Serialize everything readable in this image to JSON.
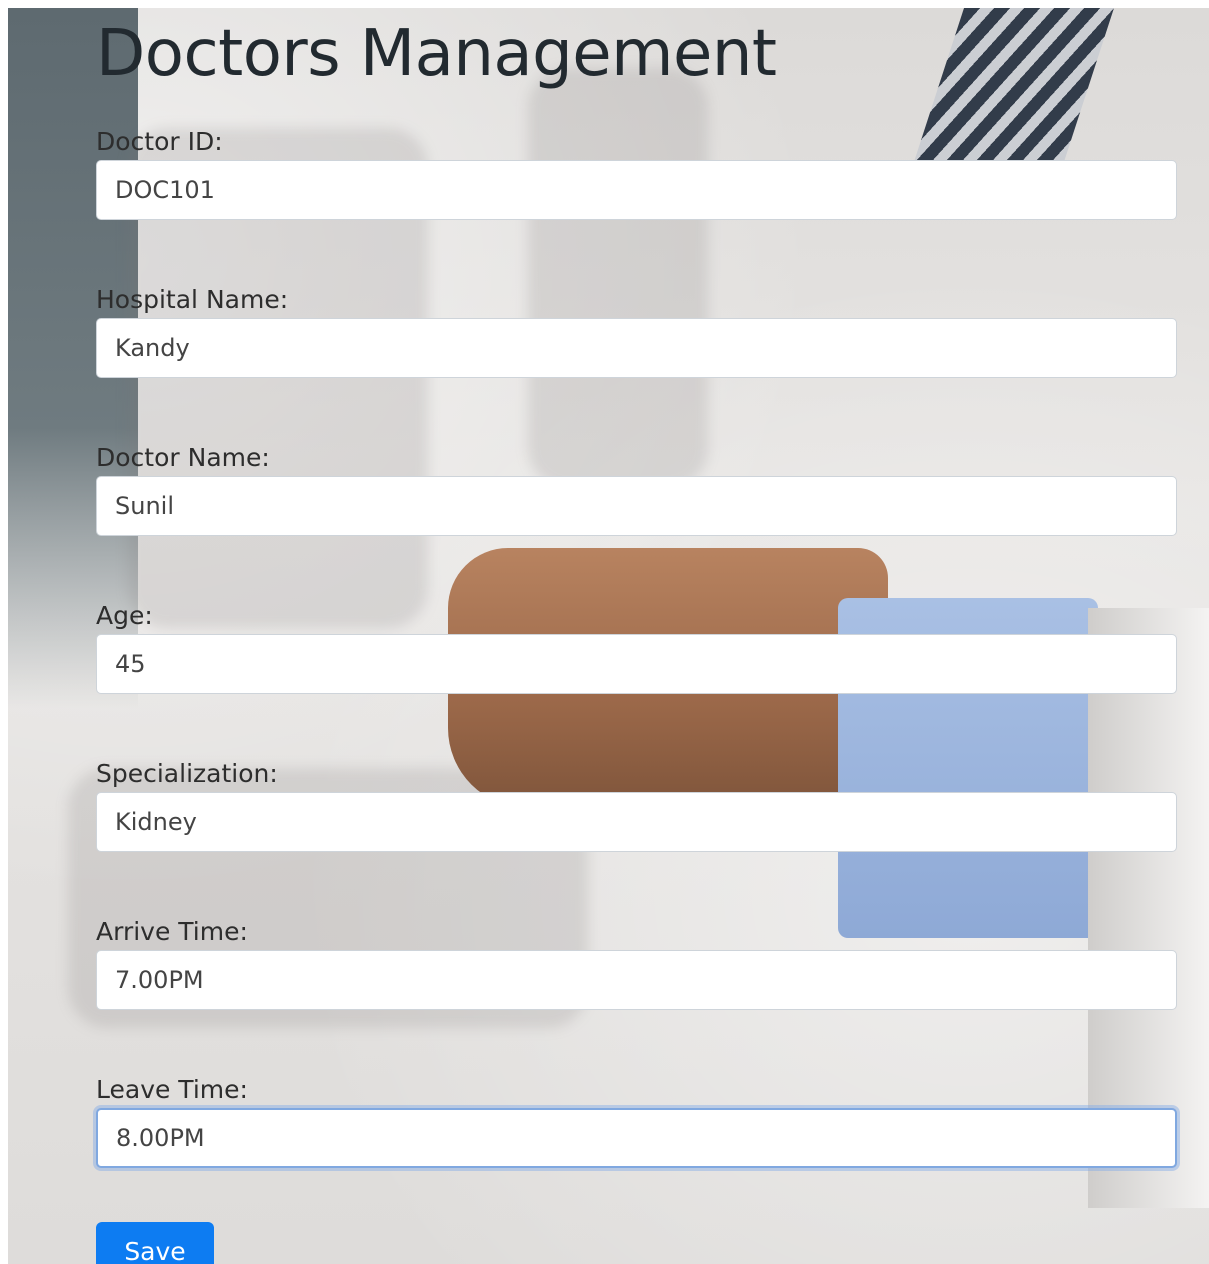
{
  "page": {
    "title": "Doctors Management"
  },
  "form": {
    "fields": [
      {
        "label": "Doctor ID:",
        "value": "DOC101"
      },
      {
        "label": "Hospital Name:",
        "value": "Kandy"
      },
      {
        "label": "Doctor Name:",
        "value": "Sunil"
      },
      {
        "label": "Age:",
        "value": "45"
      },
      {
        "label": "Specialization:",
        "value": "Kidney"
      },
      {
        "label": "Arrive Time:",
        "value": "7.00PM"
      },
      {
        "label": "Leave Time:",
        "value": "8.00PM"
      }
    ],
    "save_label": "Save"
  },
  "colors": {
    "primary_button": "#0d7cf2",
    "focus_ring": "#80a8e0",
    "title_text": "#222a30"
  }
}
